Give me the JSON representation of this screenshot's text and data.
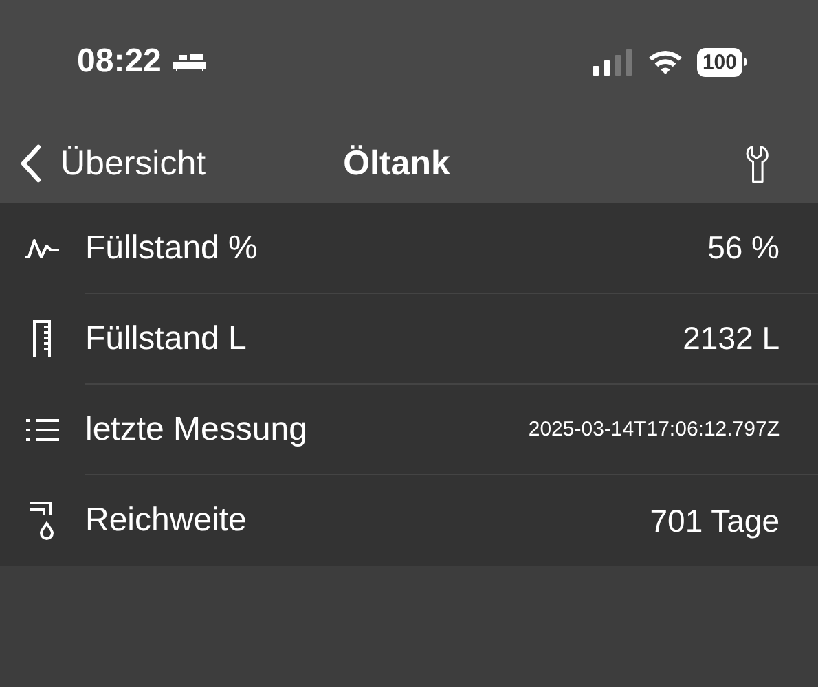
{
  "status_bar": {
    "time": "08:22",
    "battery": "100"
  },
  "nav": {
    "back": "Übersicht",
    "title": "Öltank"
  },
  "rows": [
    {
      "label": "Füllstand %",
      "value": "56 %"
    },
    {
      "label": "Füllstand L",
      "value": "2132 L"
    },
    {
      "label": "letzte Messung",
      "value": "2025-03-14T17:06:12.797Z"
    },
    {
      "label": "Reichweite",
      "value": "701 Tage"
    }
  ]
}
